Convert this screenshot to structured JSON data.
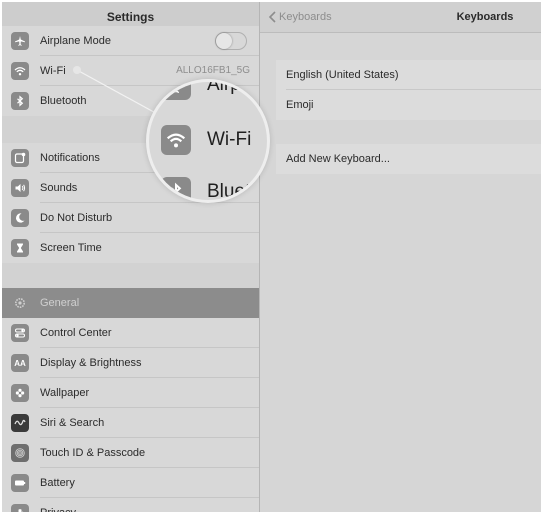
{
  "left_pane": {
    "title": "Settings",
    "group1": [
      {
        "label": "Airplane Mode",
        "icon": "airplane-icon",
        "toggle": false
      },
      {
        "label": "Wi-Fi",
        "icon": "wifi-icon",
        "value": "ALLO16FB1_5G"
      },
      {
        "label": "Bluetooth",
        "icon": "bluetooth-icon"
      }
    ],
    "group2": [
      {
        "label": "Notifications",
        "icon": "notifications-icon"
      },
      {
        "label": "Sounds",
        "icon": "speaker-icon"
      },
      {
        "label": "Do Not Disturb",
        "icon": "moon-icon"
      },
      {
        "label": "Screen Time",
        "icon": "hourglass-icon"
      }
    ],
    "group3": [
      {
        "label": "General",
        "icon": "gear-icon",
        "selected": true
      },
      {
        "label": "Control Center",
        "icon": "switches-icon"
      },
      {
        "label": "Display & Brightness",
        "icon": "aa-icon",
        "icon_text": "AA"
      },
      {
        "label": "Wallpaper",
        "icon": "flower-icon"
      },
      {
        "label": "Siri & Search",
        "icon": "siri-icon"
      },
      {
        "label": "Touch ID & Passcode",
        "icon": "fingerprint-icon"
      },
      {
        "label": "Battery",
        "icon": "battery-icon"
      },
      {
        "label": "Privacy",
        "icon": "hand-icon"
      }
    ]
  },
  "right_pane": {
    "back_label": "Keyboards",
    "title": "Keyboards",
    "keyboards": [
      "English (United States)",
      "Emoji"
    ],
    "add_label": "Add New Keyboard..."
  },
  "magnifier": {
    "rows": [
      {
        "label": "Airplane Mode",
        "icon": "airplane-icon"
      },
      {
        "label": "Wi-Fi",
        "icon": "wifi-icon"
      },
      {
        "label": "Bluetooth",
        "icon": "bluetooth-icon"
      }
    ]
  }
}
